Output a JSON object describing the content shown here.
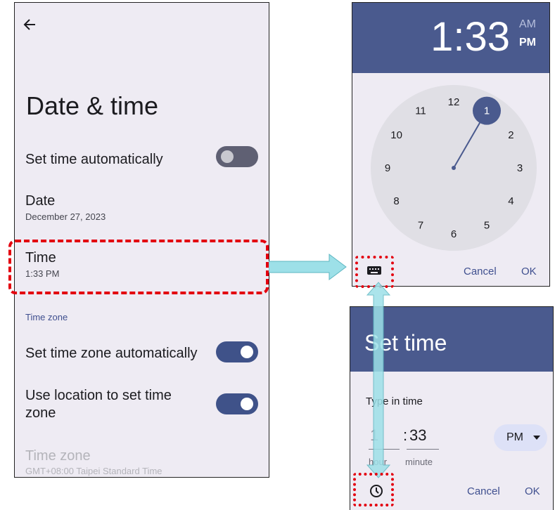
{
  "settings": {
    "title": "Date & time",
    "set_time_auto": {
      "label": "Set time automatically",
      "enabled": false
    },
    "date": {
      "label": "Date",
      "value": "December 27, 2023"
    },
    "time": {
      "label": "Time",
      "value": "1:33 PM"
    },
    "section_time_zone": "Time zone",
    "set_tz_auto": {
      "label": "Set time zone automatically",
      "enabled": true
    },
    "use_location": {
      "label_line1": "Use location to set time",
      "label_line2": "zone",
      "enabled": true
    },
    "time_zone": {
      "label": "Time zone",
      "value": "GMT+08:00 Taipei Standard Time"
    }
  },
  "clock_dialog": {
    "hour": "1",
    "time_display": "1:33",
    "am": "AM",
    "pm": "PM",
    "selected_period": "PM",
    "dial_numbers": [
      "12",
      "1",
      "2",
      "3",
      "4",
      "5",
      "6",
      "7",
      "8",
      "9",
      "10",
      "11"
    ],
    "selected_hour": 1,
    "cancel": "Cancel",
    "ok": "OK",
    "mode_icon": "keyboard-icon"
  },
  "set_time_dialog": {
    "title": "Set time",
    "instruction": "Type in time",
    "hour_value": "1",
    "separator": ":",
    "minute_value": "33",
    "hour_caption": "hour",
    "minute_caption": "minute",
    "period": "PM",
    "cancel": "Cancel",
    "ok": "OK",
    "mode_icon": "clock-icon"
  },
  "colors": {
    "accent": "#4a5a8e",
    "highlight": "#e3000f",
    "arrow": "#9de0e8",
    "background": "#eeebf3"
  }
}
